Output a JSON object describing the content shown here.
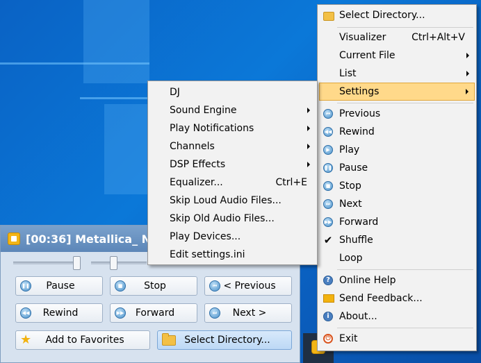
{
  "player": {
    "title": "[00:36] Metallica_ No",
    "buttons": {
      "pause": "Pause",
      "stop": "Stop",
      "previous": "< Previous",
      "rewind": "Rewind",
      "forward": "Forward",
      "next": "Next >",
      "add_favorites": "Add to Favorites",
      "select_directory": "Select Directory..."
    }
  },
  "main_menu": {
    "items": [
      {
        "label": "Select Directory...",
        "icon": "folder-icon"
      },
      {
        "label": "Visualizer",
        "shortcut": "Ctrl+Alt+V"
      },
      {
        "label": "Current File",
        "submenu": true
      },
      {
        "label": "List",
        "submenu": true
      },
      {
        "label": "Settings",
        "submenu": true,
        "highlighted": true
      },
      {
        "label": "Previous",
        "icon": "previous-icon"
      },
      {
        "label": "Rewind",
        "icon": "rewind-icon"
      },
      {
        "label": "Play",
        "icon": "play-icon"
      },
      {
        "label": "Pause",
        "icon": "pause-icon"
      },
      {
        "label": "Stop",
        "icon": "stop-icon"
      },
      {
        "label": "Next",
        "icon": "next-icon"
      },
      {
        "label": "Forward",
        "icon": "forward-icon"
      },
      {
        "label": "Shuffle",
        "checked": true
      },
      {
        "label": "Loop"
      },
      {
        "label": "Online Help",
        "icon": "help-icon"
      },
      {
        "label": "Send Feedback...",
        "icon": "feedback-icon"
      },
      {
        "label": "About...",
        "icon": "info-icon"
      },
      {
        "label": "Exit",
        "icon": "exit-icon"
      }
    ]
  },
  "settings_menu": {
    "items": [
      {
        "label": "DJ"
      },
      {
        "label": "Sound Engine",
        "submenu": true
      },
      {
        "label": "Play Notifications",
        "submenu": true
      },
      {
        "label": "Channels",
        "submenu": true
      },
      {
        "label": "DSP Effects",
        "submenu": true
      },
      {
        "label": "Equalizer...",
        "shortcut": "Ctrl+E"
      },
      {
        "label": "Skip Loud Audio Files..."
      },
      {
        "label": "Skip Old Audio Files..."
      },
      {
        "label": "Play Devices..."
      },
      {
        "label": "Edit settings.ini"
      }
    ]
  },
  "colors": {
    "menu_highlight": "#ffd98a",
    "desktop": "#0b78d8",
    "player_bg": "#d7e2ef"
  }
}
